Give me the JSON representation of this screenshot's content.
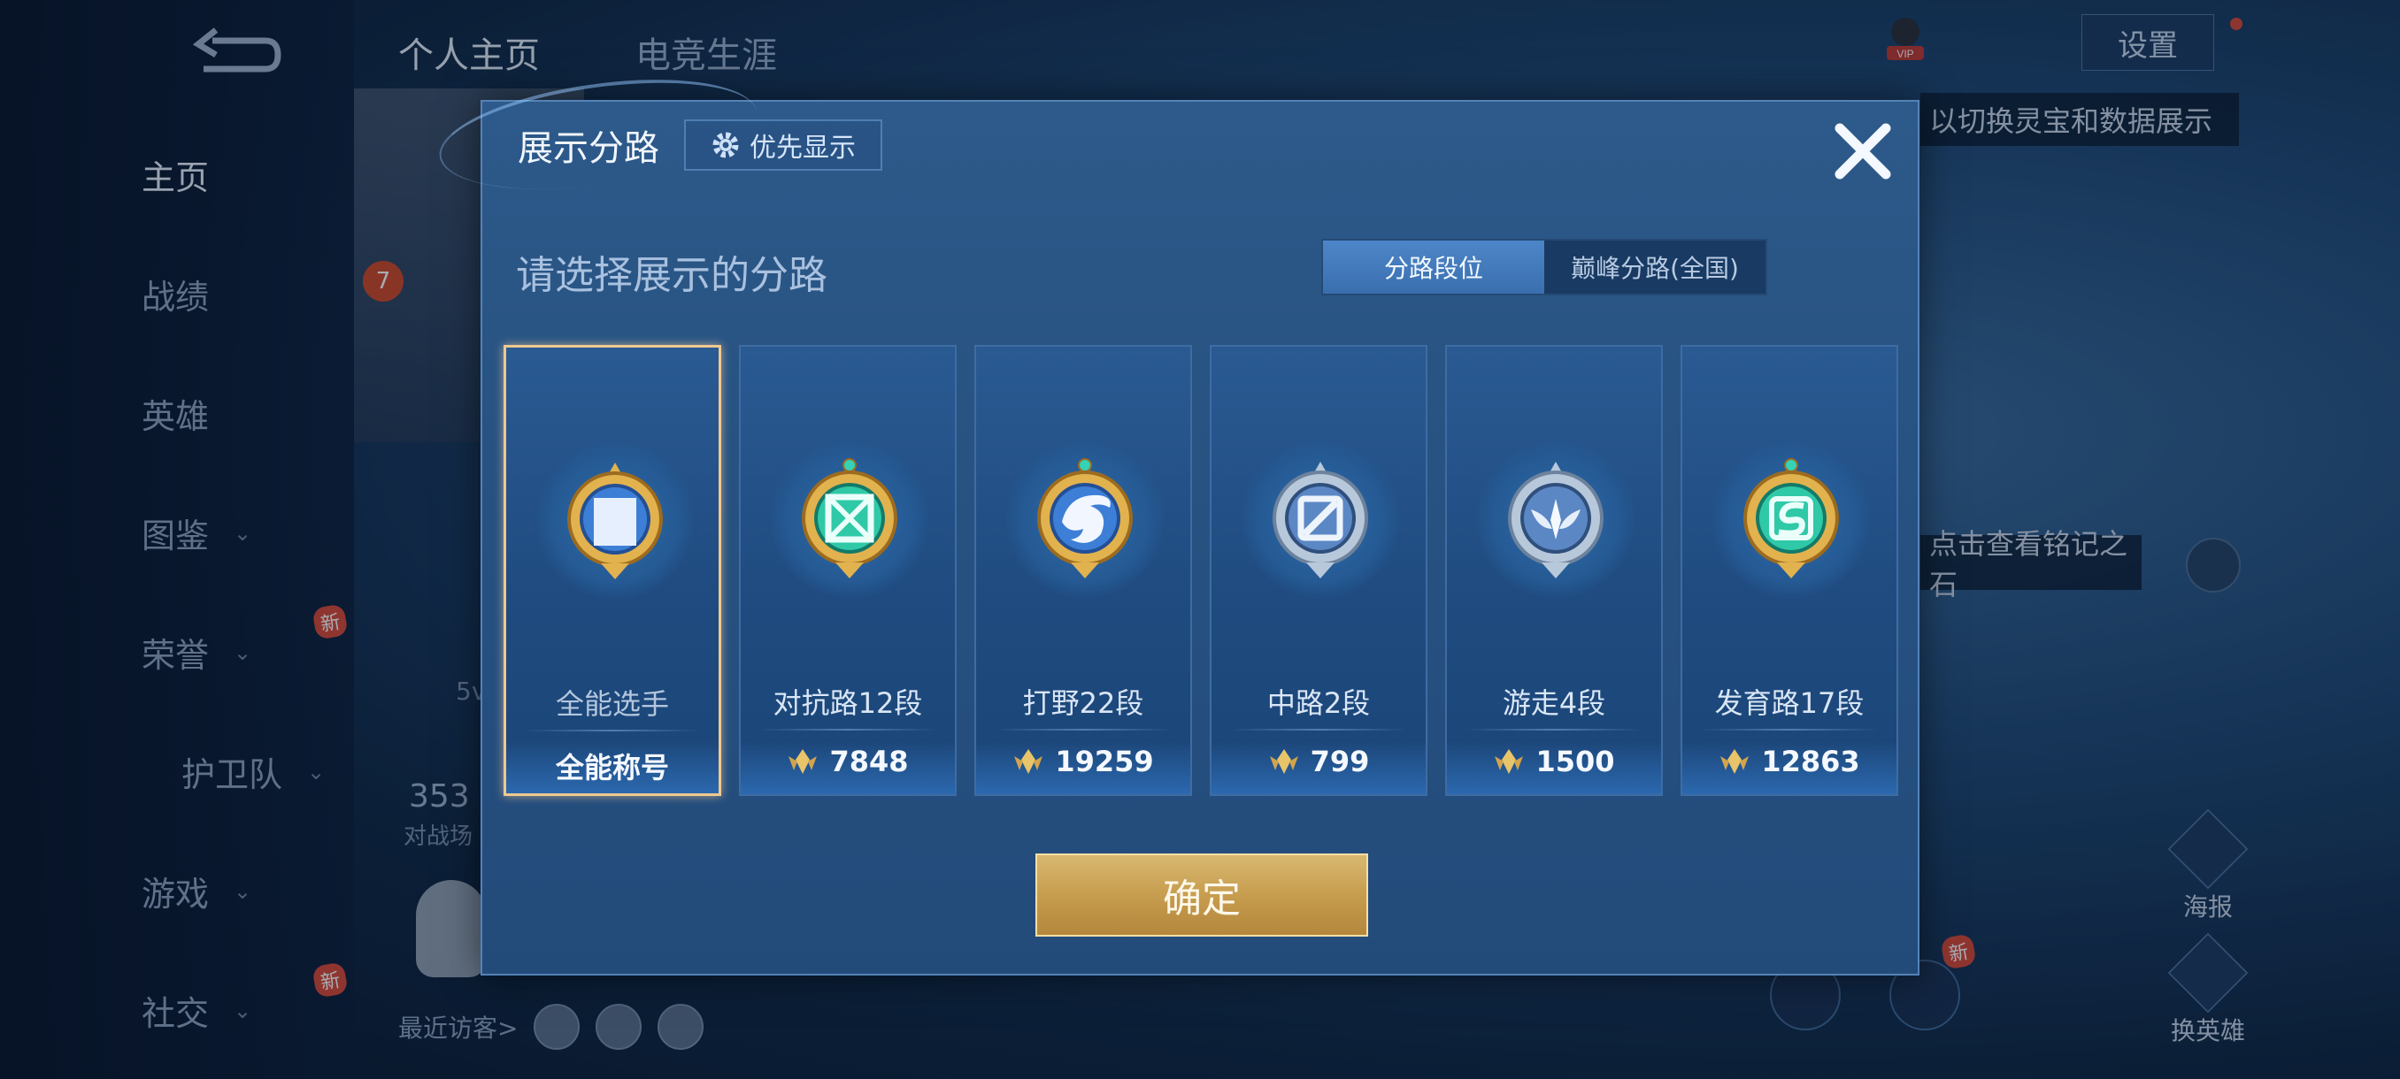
{
  "background": {
    "nav": [
      {
        "label": "主页",
        "chevron": false,
        "badge": ""
      },
      {
        "label": "战绩",
        "chevron": false,
        "badge": ""
      },
      {
        "label": "英雄",
        "chevron": false,
        "badge": ""
      },
      {
        "label": "图鉴",
        "chevron": true,
        "badge": ""
      },
      {
        "label": "荣誉",
        "chevron": true,
        "badge": "新"
      },
      {
        "label": "护卫队",
        "chevron": true,
        "badge": ""
      },
      {
        "label": "游戏",
        "chevron": true,
        "badge": ""
      },
      {
        "label": "社交",
        "chevron": true,
        "badge": "新"
      }
    ],
    "top_tabs": [
      "个人主页",
      "电竞生涯"
    ],
    "level": "7",
    "stat_number": "353",
    "stat_sub": "对战场",
    "fivev": "5v",
    "recent_visitors_label": "最近访客>",
    "vip_label": "VIP",
    "settings_label": "设置",
    "tip_switch": "以切换灵宝和数据展示",
    "tip_inscription": "点击查看铭记之石",
    "side_buttons": [
      "海报",
      "换英雄"
    ],
    "side_badge": "新"
  },
  "modal": {
    "title": "展示分路",
    "priority_button": "优先显示",
    "subtitle": "请选择展示的分路",
    "segments": [
      "分路段位",
      "巅峰分路(全国)"
    ],
    "active_segment": 0,
    "cards": [
      {
        "label": "全能选手",
        "value": "全能称号",
        "has_score": false,
        "selected": true,
        "emblem": "all-round-emblem"
      },
      {
        "label": "对抗路12段",
        "value": "7848",
        "has_score": true,
        "selected": false,
        "emblem": "clash-lane-emblem"
      },
      {
        "label": "打野22段",
        "value": "19259",
        "has_score": true,
        "selected": false,
        "emblem": "jungle-emblem"
      },
      {
        "label": "中路2段",
        "value": "799",
        "has_score": true,
        "selected": false,
        "emblem": "mid-lane-emblem"
      },
      {
        "label": "游走4段",
        "value": "1500",
        "has_score": true,
        "selected": false,
        "emblem": "roam-emblem"
      },
      {
        "label": "发育路17段",
        "value": "12863",
        "has_score": true,
        "selected": false,
        "emblem": "farm-lane-emblem"
      }
    ],
    "confirm_button": "确定"
  },
  "colors": {
    "accent_gold": "#c79d4f",
    "selected_border": "#f0c890",
    "segment_active": "#3a6faf",
    "modal_bg": "#275282"
  }
}
